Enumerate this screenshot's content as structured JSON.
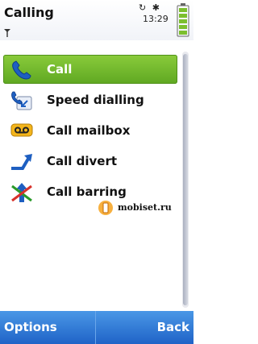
{
  "header": {
    "title": "Calling",
    "time": "13:29",
    "status_icons": "↻ ✱",
    "signal_icon": "signal-icon",
    "battery_icon": "battery-icon"
  },
  "menu": {
    "items": [
      {
        "label": "Call",
        "icon": "phone-handset-icon",
        "selected": true
      },
      {
        "label": "Speed dialling",
        "icon": "speed-dial-icon",
        "selected": false
      },
      {
        "label": "Call mailbox",
        "icon": "voicemail-icon",
        "selected": false
      },
      {
        "label": "Call divert",
        "icon": "divert-arrow-icon",
        "selected": false
      },
      {
        "label": "Call barring",
        "icon": "barring-icon",
        "selected": false
      }
    ]
  },
  "watermark": {
    "text": "mobiset.ru"
  },
  "softkeys": {
    "left": "Options",
    "right": "Back"
  },
  "colors": {
    "selection": "#6cb52a",
    "softkey_bar": "#2f7bd8"
  }
}
